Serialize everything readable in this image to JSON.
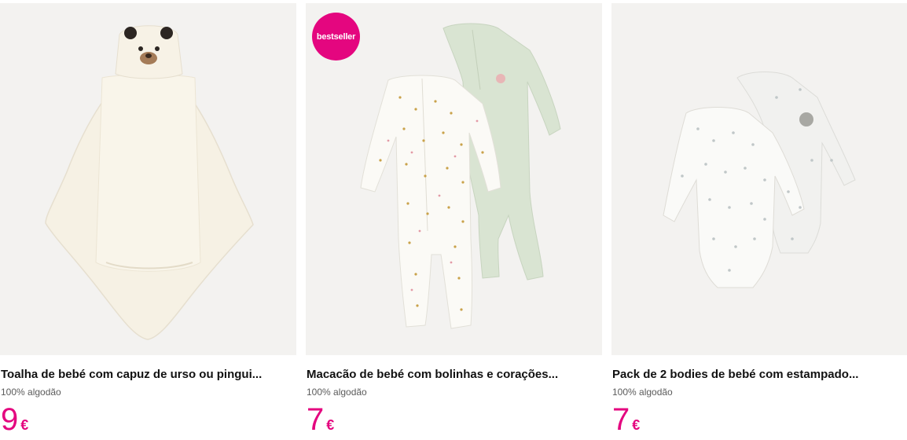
{
  "products": [
    {
      "title": "Toalha de bebé com capuz de urso ou pingui...",
      "material": "100% algodão",
      "price": "9",
      "currency": "€",
      "image_icon": "bear-hooded-towel-image"
    },
    {
      "badge": "bestseller",
      "title": "Macacão de bebé com bolinhas e corações...",
      "material": "100% algodão",
      "price": "7",
      "currency": "€",
      "image_icon": "sleepsuits-image"
    },
    {
      "title": "Pack de 2 bodies de bebé com estampado...",
      "material": "100% algodão",
      "price": "7",
      "currency": "€",
      "image_icon": "bodysuits-image"
    }
  ],
  "colors": {
    "accent": "#e4067f",
    "image_bg": "#f3f2f0"
  }
}
